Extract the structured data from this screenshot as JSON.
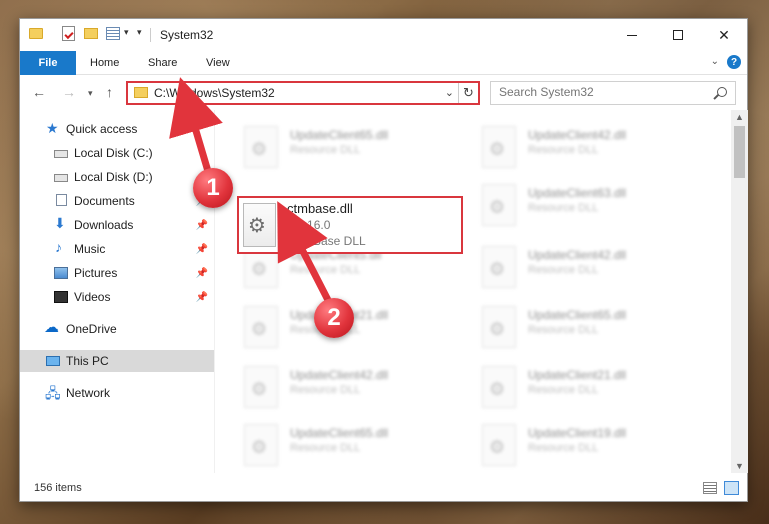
{
  "window": {
    "title": "System32",
    "controls": {
      "minimize": "—",
      "maximize": "☐",
      "close": "✕"
    }
  },
  "ribbon": {
    "tabs": [
      "File",
      "Home",
      "Share",
      "View"
    ],
    "help": "?"
  },
  "navigation": {
    "address": "C:\\Windows\\System32",
    "search_placeholder": "Search System32"
  },
  "sidebar": {
    "items": [
      {
        "label": "Quick access",
        "icon": "star-icon",
        "pinned": false
      },
      {
        "label": "Local Disk (C:)",
        "icon": "drive-icon",
        "pinned": false
      },
      {
        "label": "Local Disk (D:)",
        "icon": "drive-icon",
        "pinned": false
      },
      {
        "label": "Documents",
        "icon": "documents-icon",
        "pinned": true
      },
      {
        "label": "Downloads",
        "icon": "download-icon",
        "pinned": true
      },
      {
        "label": "Music",
        "icon": "music-icon",
        "pinned": true
      },
      {
        "label": "Pictures",
        "icon": "pictures-icon",
        "pinned": true
      },
      {
        "label": "Videos",
        "icon": "video-icon",
        "pinned": true
      },
      {
        "label": "OneDrive",
        "icon": "cloud-icon",
        "pinned": false
      },
      {
        "label": "This PC",
        "icon": "computer-icon",
        "pinned": false,
        "selected": true
      },
      {
        "label": "Network",
        "icon": "network-icon",
        "pinned": false
      }
    ]
  },
  "files": {
    "highlighted": {
      "name": "ctmbase.dll",
      "version": "1.0.16.0",
      "type": "CTMBase DLL"
    },
    "blurred_tiles": [
      {
        "name": "UpdateClient65.dll",
        "type": "Resource DLL"
      },
      {
        "name": "UpdateClient42.dll",
        "type": "Resource DLL"
      },
      {
        "name": "UpdateClient63.dll",
        "type": "Resource DLL"
      },
      {
        "name": "UpdateClient5.dll",
        "type": "Resource DLL"
      },
      {
        "name": "UpdateClient42.dll",
        "type": "Resource DLL"
      },
      {
        "name": "UpdateClient21.dll",
        "type": "Resource DLL"
      },
      {
        "name": "UpdateClient65.dll",
        "type": "Resource DLL"
      },
      {
        "name": "UpdateClient42.dll",
        "type": "Resource DLL"
      },
      {
        "name": "UpdateClient21.dll",
        "type": "Resource DLL"
      },
      {
        "name": "UpdateClient65.dll",
        "type": "Resource DLL"
      },
      {
        "name": "UpdateClient19.dll",
        "type": "Resource DLL"
      }
    ]
  },
  "status": {
    "item_count": "156 items"
  },
  "annotations": {
    "step1": "1",
    "step2": "2",
    "color": "#e1343c"
  }
}
